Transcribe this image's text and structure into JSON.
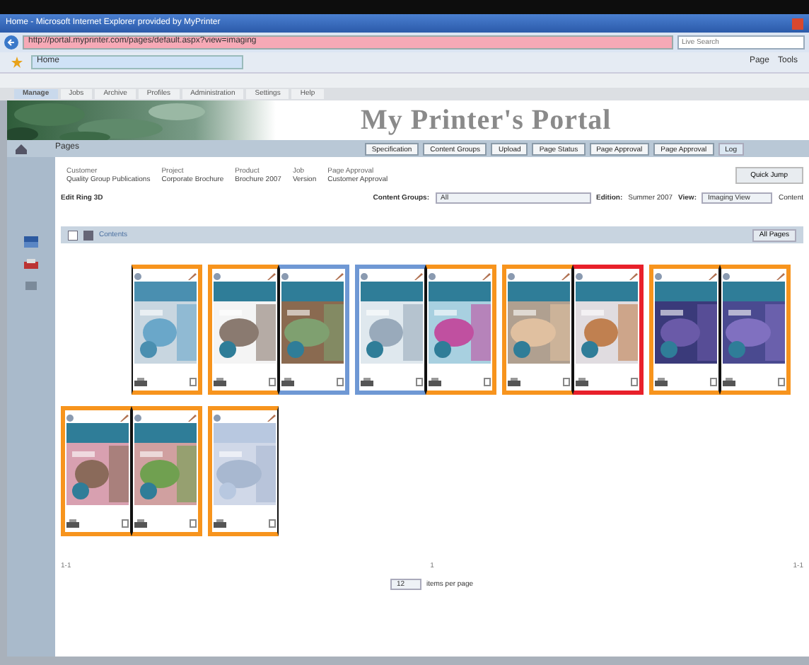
{
  "browser": {
    "title": "Home - Microsoft Internet Explorer provided by MyPrinter",
    "address": "http://portal.myprinter.com/pages/default.aspx?view=imaging",
    "search_placeholder": "Live Search",
    "tab": "Home",
    "commands": [
      "Page",
      "Tools"
    ]
  },
  "app_menu": [
    {
      "label": "Manage",
      "selected": true
    },
    {
      "label": "Jobs",
      "selected": false
    },
    {
      "label": "Archive",
      "selected": false
    },
    {
      "label": "Profiles",
      "selected": false
    },
    {
      "label": "Administration",
      "selected": false
    },
    {
      "label": "Settings",
      "selected": false
    },
    {
      "label": "Help",
      "selected": false
    }
  ],
  "banner": {
    "title": "My Printer's Portal"
  },
  "breadcrumb": "Pages",
  "tabs": [
    {
      "label": "Specification",
      "selected": false
    },
    {
      "label": "Content Groups",
      "selected": false
    },
    {
      "label": "Upload",
      "selected": false
    },
    {
      "label": "Page Status",
      "selected": false
    },
    {
      "label": "Page Approval",
      "selected": false
    },
    {
      "label": "Page Approval",
      "selected": false
    },
    {
      "label": "Log",
      "selected": true
    }
  ],
  "job_info": [
    {
      "label": "Customer",
      "value": "Quality Group Publications"
    },
    {
      "label": "Project",
      "value": "Corporate Brochure"
    },
    {
      "label": "Product",
      "value": "Brochure 2007"
    },
    {
      "label": "Job",
      "value": "Version"
    },
    {
      "label": "Page Approval",
      "value": "Customer Approval"
    }
  ],
  "quick_jump": "Quick Jump",
  "filters": {
    "job_name": "Edit Ring 3D",
    "content_groups_label": "Content Groups:",
    "content_groups": "All",
    "edition_label": "Edition:",
    "edition": "Summer 2007",
    "view_label": "View:",
    "view": "Imaging View",
    "content_nav": "Content"
  },
  "section": {
    "title": "Contents",
    "button": "All Pages"
  },
  "spreads": [
    {
      "right": {
        "color": "#f7941d"
      }
    },
    {
      "left": {
        "color": "#f7941d"
      },
      "right": {
        "color": "#6f98d4"
      }
    },
    {
      "left": {
        "color": "#6f98d4"
      },
      "right": {
        "color": "#f7941d"
      }
    },
    {
      "left": {
        "color": "#f7941d"
      },
      "right": {
        "color": "#e8202a"
      }
    },
    {
      "left": {
        "color": "#f7941d"
      },
      "right": {
        "color": "#f7941d"
      }
    },
    {
      "left": {
        "color": "#f7941d"
      },
      "right": {
        "color": "#f7941d"
      }
    },
    {
      "left": {
        "color": "#f7941d"
      }
    }
  ],
  "pager": {
    "first": "1-1",
    "page": "1",
    "last": "1-1",
    "page_size": "12",
    "page_size_label": "items per page"
  }
}
